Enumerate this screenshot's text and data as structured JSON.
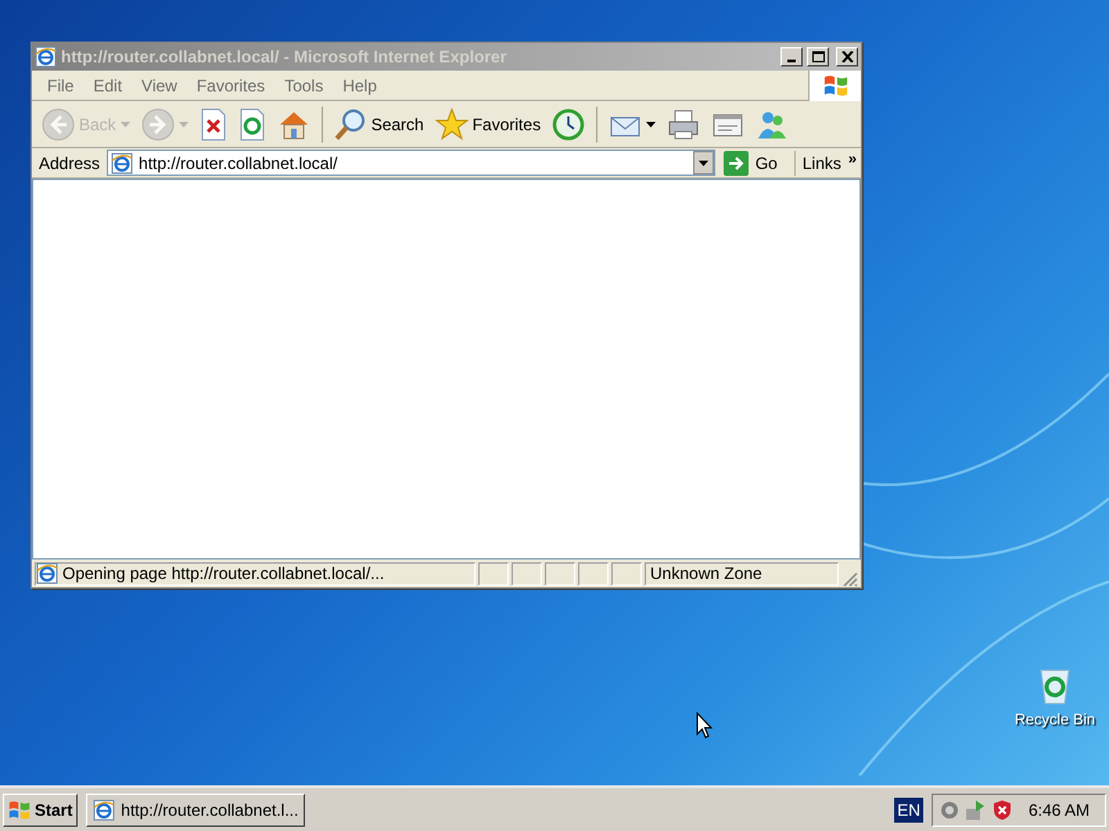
{
  "window": {
    "title": "http://router.collabnet.local/ - Microsoft Internet Explorer",
    "active": false
  },
  "menu": [
    "File",
    "Edit",
    "View",
    "Favorites",
    "Tools",
    "Help"
  ],
  "toolbar": [
    {
      "kind": "back",
      "label": "Back",
      "disabled": true,
      "dropdown": true
    },
    {
      "kind": "forward",
      "disabled": true,
      "dropdown": true
    },
    {
      "kind": "stop",
      "disabled": false
    },
    {
      "kind": "refresh",
      "disabled": false
    },
    {
      "kind": "home",
      "disabled": false
    },
    {
      "kind": "separator"
    },
    {
      "kind": "search",
      "label": "Search",
      "disabled": false
    },
    {
      "kind": "favorites",
      "label": "Favorites",
      "disabled": false
    },
    {
      "kind": "history",
      "disabled": false
    },
    {
      "kind": "separator"
    },
    {
      "kind": "mail",
      "disabled": false,
      "dropdown": true
    },
    {
      "kind": "print",
      "disabled": false
    },
    {
      "kind": "edit",
      "disabled": false
    },
    {
      "kind": "messenger",
      "disabled": false
    }
  ],
  "address_bar": {
    "label": "Address",
    "value": "http://router.collabnet.local/",
    "go": "Go",
    "links": "Links",
    "more": "»"
  },
  "status_bar": {
    "text": "Opening page http://router.collabnet.local/...",
    "zone": "Unknown Zone"
  },
  "desktop_icons": [
    {
      "label": "Recycle Bin"
    }
  ],
  "taskbar": {
    "start": "Start",
    "tasks": [
      {
        "label": "http://router.collabnet.l...",
        "selected": false
      }
    ],
    "language": "EN",
    "clock": "6:46 AM"
  }
}
